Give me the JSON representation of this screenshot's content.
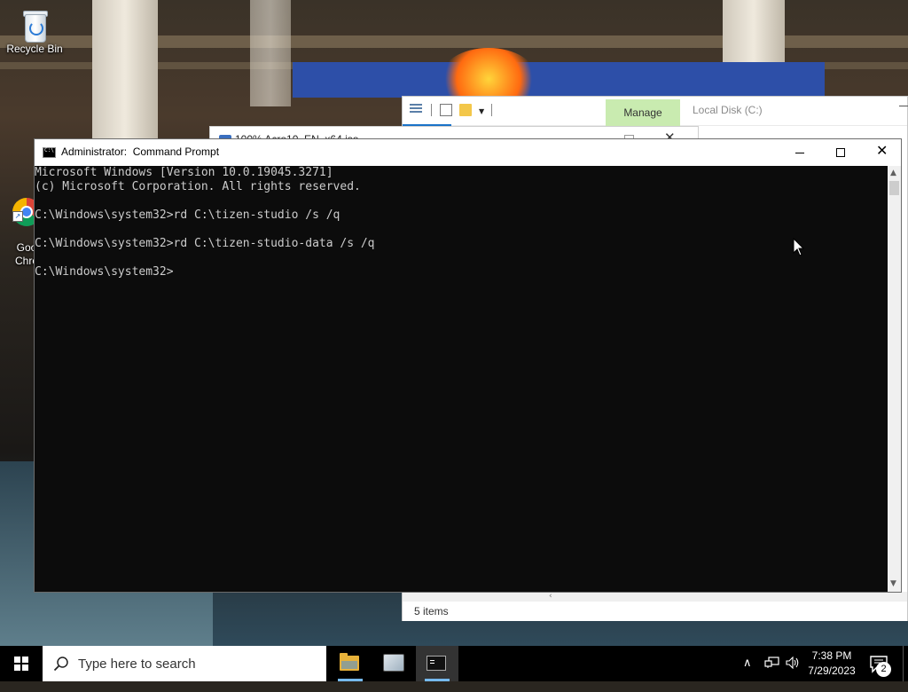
{
  "desktop": {
    "icons": [
      {
        "label": "Recycle Bin",
        "icon": "recycle-bin-icon"
      },
      {
        "label": "Goo\nChro",
        "icon": "chrome-icon"
      }
    ]
  },
  "explorer": {
    "manage_tab": "Manage",
    "title": "Local Disk (C:)",
    "status": "5 items"
  },
  "background_window": {
    "title": "100% Acro10_EN_x64.iso"
  },
  "cmd": {
    "title": "Administrator:  Command Prompt",
    "lines": [
      "Microsoft Windows [Version 10.0.19045.3271]",
      "(c) Microsoft Corporation. All rights reserved.",
      "",
      "C:\\Windows\\system32>rd C:\\tizen-studio /s /q",
      "",
      "C:\\Windows\\system32>rd C:\\tizen-studio-data /s /q",
      "",
      "C:\\Windows\\system32>"
    ]
  },
  "taskbar": {
    "search_placeholder": "Type here to search",
    "apps": [
      {
        "name": "File Explorer",
        "icon": "file-explorer-icon",
        "running": true
      },
      {
        "name": "Tools",
        "icon": "tools-icon",
        "running": false
      },
      {
        "name": "Command Prompt",
        "icon": "cmd-icon",
        "running": true,
        "active": true
      }
    ],
    "clock_time": "7:38 PM",
    "clock_date": "7/29/2023",
    "notification_count": "2"
  },
  "colors": {
    "console_bg": "#0c0c0c",
    "console_fg": "#cccccc",
    "manage_tab": "#c9ebb0",
    "taskbar": "#000000",
    "taskbar_active_underline": "#76b9ed"
  }
}
